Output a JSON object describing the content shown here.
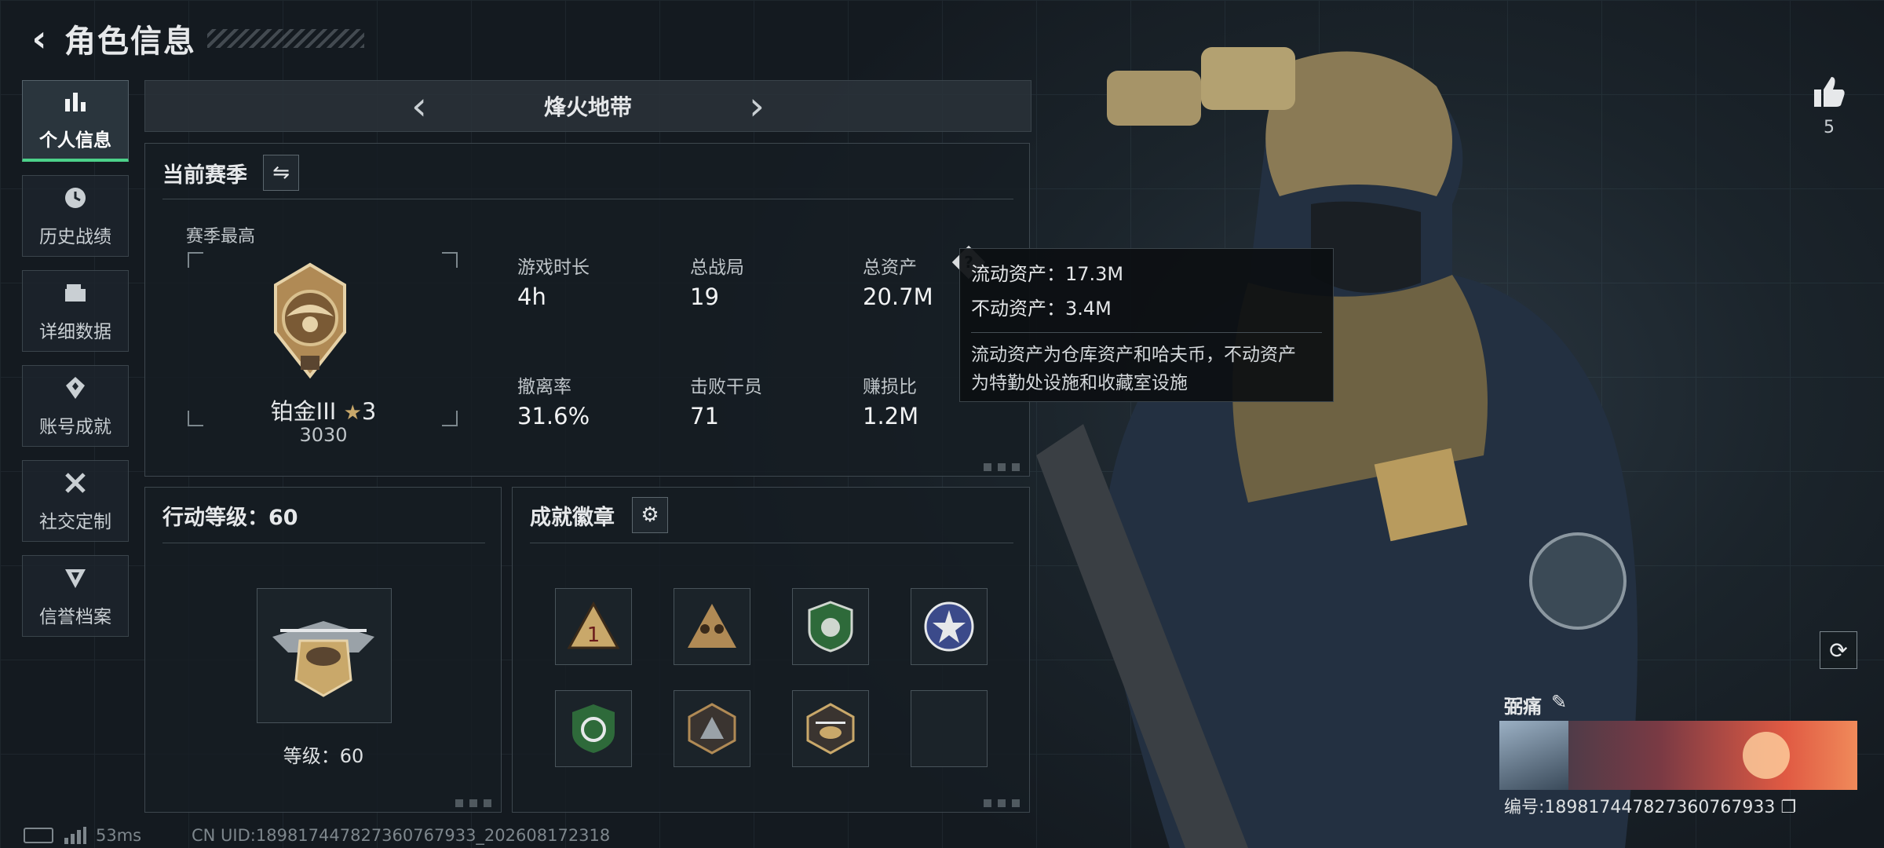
{
  "header": {
    "title": "角色信息"
  },
  "nav": [
    {
      "label": "个人信息",
      "icon": "bar-chart-icon",
      "active": true
    },
    {
      "label": "历史战绩",
      "icon": "history-icon"
    },
    {
      "label": "详细数据",
      "icon": "folder-icon"
    },
    {
      "label": "账号成就",
      "icon": "achievement-icon"
    },
    {
      "label": "社交定制",
      "icon": "tools-icon"
    },
    {
      "label": "信誉档案",
      "icon": "shield-icon"
    }
  ],
  "mode_bar": {
    "name": "烽火地带"
  },
  "season": {
    "title": "当前赛季",
    "best_label": "赛季最高",
    "rank": {
      "name": "铂金III",
      "stars": "3",
      "score": "3030"
    },
    "stats": [
      {
        "label": "游戏时长",
        "value": "4h"
      },
      {
        "label": "总战局",
        "value": "19"
      },
      {
        "label": "总资产",
        "value": "20.7M"
      },
      {
        "label": "撤离率",
        "value": "31.6%"
      },
      {
        "label": "击败干员",
        "value": "71"
      },
      {
        "label": "赚损比",
        "value": "1.2M"
      }
    ]
  },
  "tooltip": {
    "liquid": "流动资产：17.3M",
    "fixed": "不动资产：3.4M",
    "desc_line1": "流动资产为仓库资产和哈夫币，不动资产",
    "desc_line2": "为特勤处设施和收藏室设施"
  },
  "action_level": {
    "title": "行动等级：60",
    "level_text": "等级：60"
  },
  "achievements": {
    "title": "成就徽章",
    "badge_count": 8
  },
  "right": {
    "like_count": "5",
    "player_name": "弼痛",
    "player_id": "编号:18981744782736076​7933"
  },
  "footer": {
    "ping": "53ms",
    "uid": "CN UID:18981744782736076​7933_202608172318"
  },
  "colors": {
    "accent": "#4cd18a",
    "gold": "#c9a86a"
  }
}
